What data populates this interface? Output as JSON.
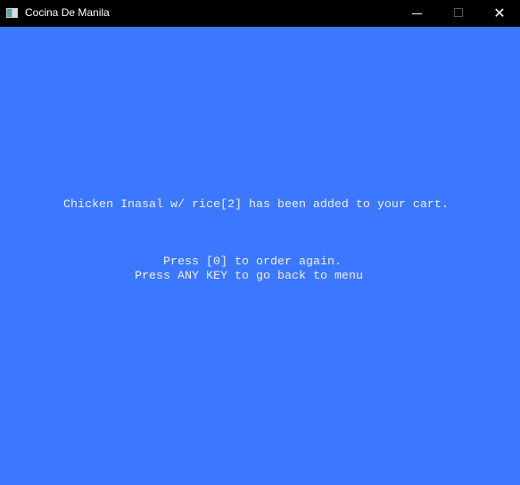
{
  "window": {
    "title": "Cocina De Manila",
    "close_glyph": "✕"
  },
  "console": {
    "added_message": "Chicken Inasal w/ rice[2] has been added to your cart.",
    "order_again": "Press [0] to order again.",
    "back_to_menu": "Press ANY KEY to go back to menu"
  }
}
